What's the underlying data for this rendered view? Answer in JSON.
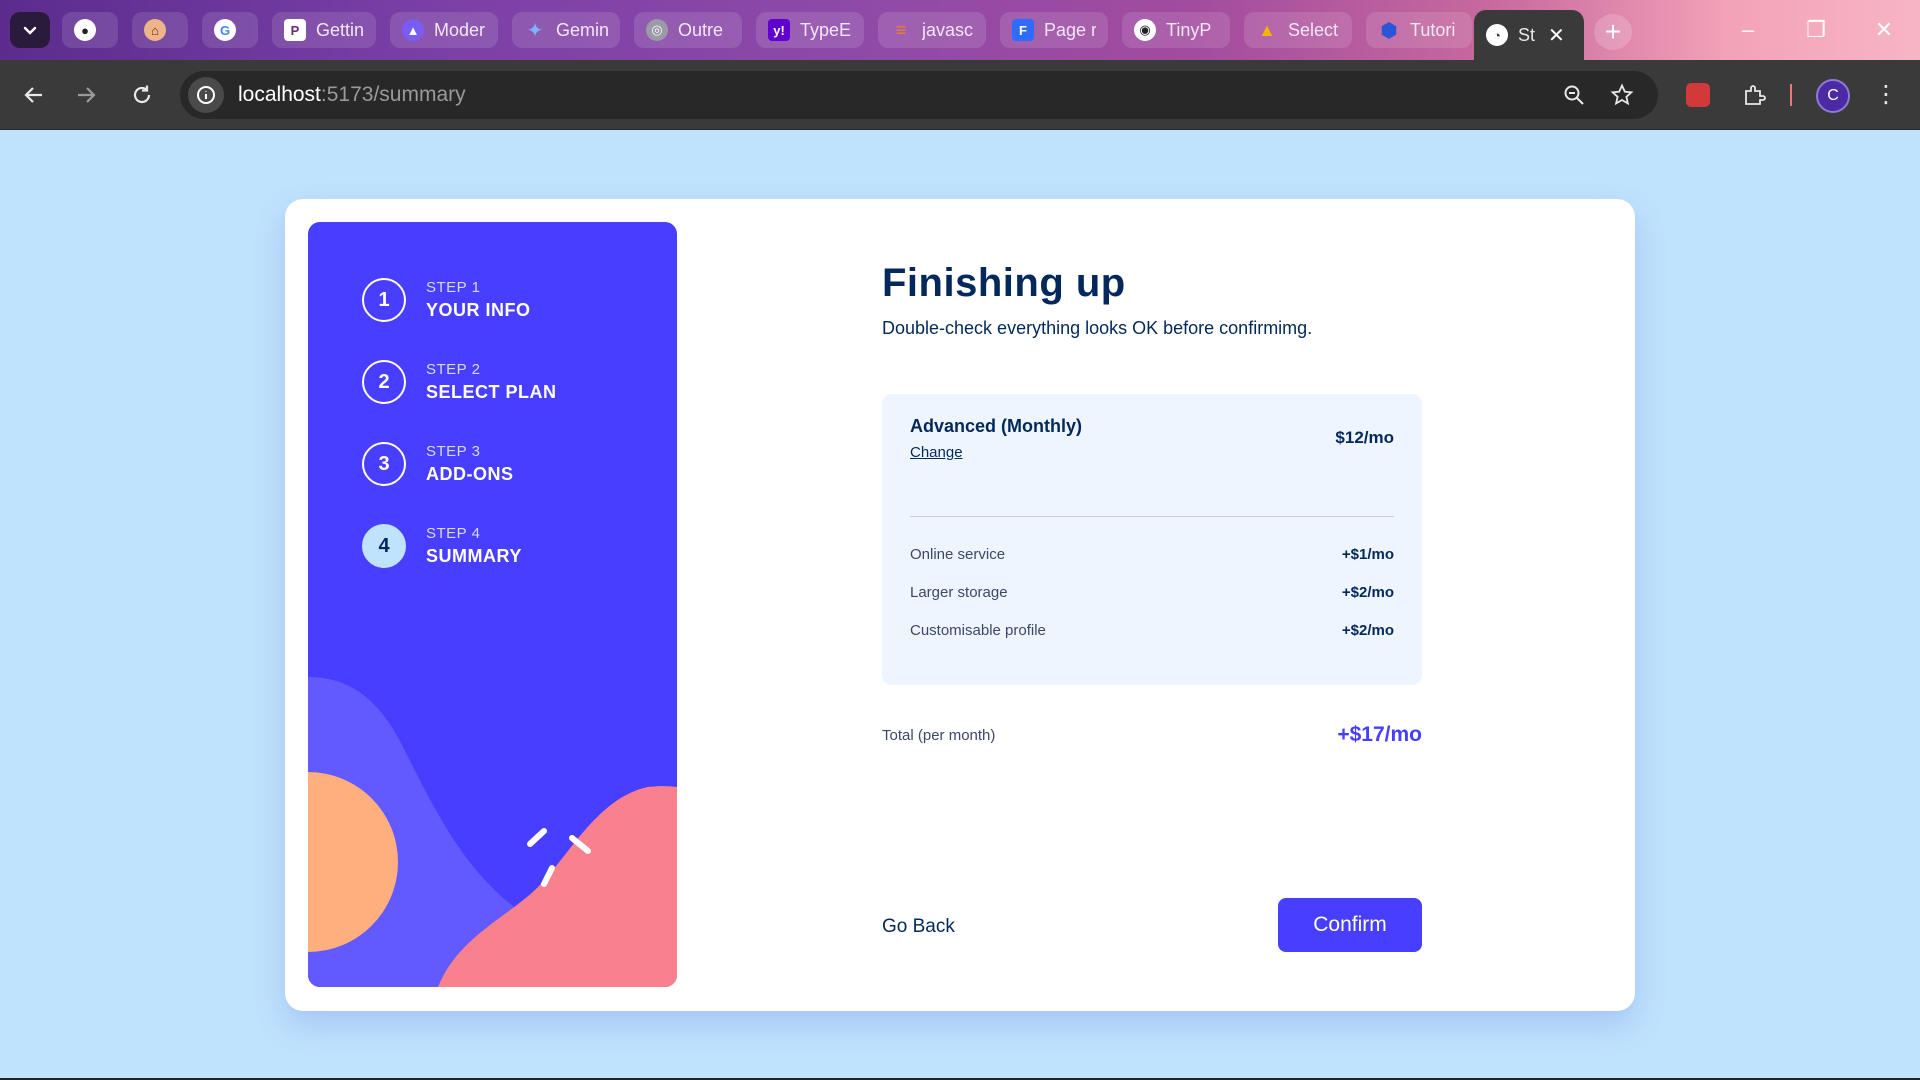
{
  "browser": {
    "tabs": [
      {
        "title": "",
        "icon": "github-icon"
      },
      {
        "title": "",
        "icon": "cat-icon"
      },
      {
        "title": "",
        "icon": "google-icon"
      },
      {
        "title": "Gettin",
        "icon": "p-icon"
      },
      {
        "title": "Moder",
        "icon": "rocket-icon"
      },
      {
        "title": "Gemin",
        "icon": "sparkle-icon"
      },
      {
        "title": "Outre",
        "icon": "globe-icon"
      },
      {
        "title": "TypeE",
        "icon": "yahoo-icon"
      },
      {
        "title": "javasc",
        "icon": "stackoverflow-icon"
      },
      {
        "title": "Page r",
        "icon": "f-icon"
      },
      {
        "title": "TinyP",
        "icon": "panda-icon"
      },
      {
        "title": "Select",
        "icon": "drive-icon"
      },
      {
        "title": "Tutori",
        "icon": "hexagon-icon"
      },
      {
        "title": "St",
        "icon": "site-icon"
      }
    ],
    "url_host": "localhost",
    "url_path": ":5173/summary",
    "profile_initial": "C"
  },
  "sidebar": {
    "steps": [
      {
        "num": "1",
        "small": "STEP 1",
        "big": "YOUR INFO"
      },
      {
        "num": "2",
        "small": "STEP 2",
        "big": "SELECT PLAN"
      },
      {
        "num": "3",
        "small": "STEP 3",
        "big": "ADD-ONS"
      },
      {
        "num": "4",
        "small": "STEP 4",
        "big": "SUMMARY"
      }
    ],
    "active_step": 4
  },
  "main": {
    "title": "Finishing up",
    "subtitle": "Double-check everything looks OK before confirmimg."
  },
  "summary": {
    "plan_name": "Advanced (Monthly)",
    "change_label": "Change",
    "plan_price": "$12/mo",
    "addons": [
      {
        "name": "Online service",
        "price": "+$1/mo"
      },
      {
        "name": "Larger storage",
        "price": "+$2/mo"
      },
      {
        "name": "Customisable profile",
        "price": "+$2/mo"
      }
    ],
    "total_label": "Total (per month)",
    "total_price": "+$17/mo"
  },
  "actions": {
    "back_label": "Go Back",
    "confirm_label": "Confirm"
  },
  "colors": {
    "page_bg": "#bfe2fd",
    "sidebar_bg": "#483eff",
    "accent": "#483eff",
    "heading": "#02295a",
    "summary_bg": "#eff5ff"
  }
}
